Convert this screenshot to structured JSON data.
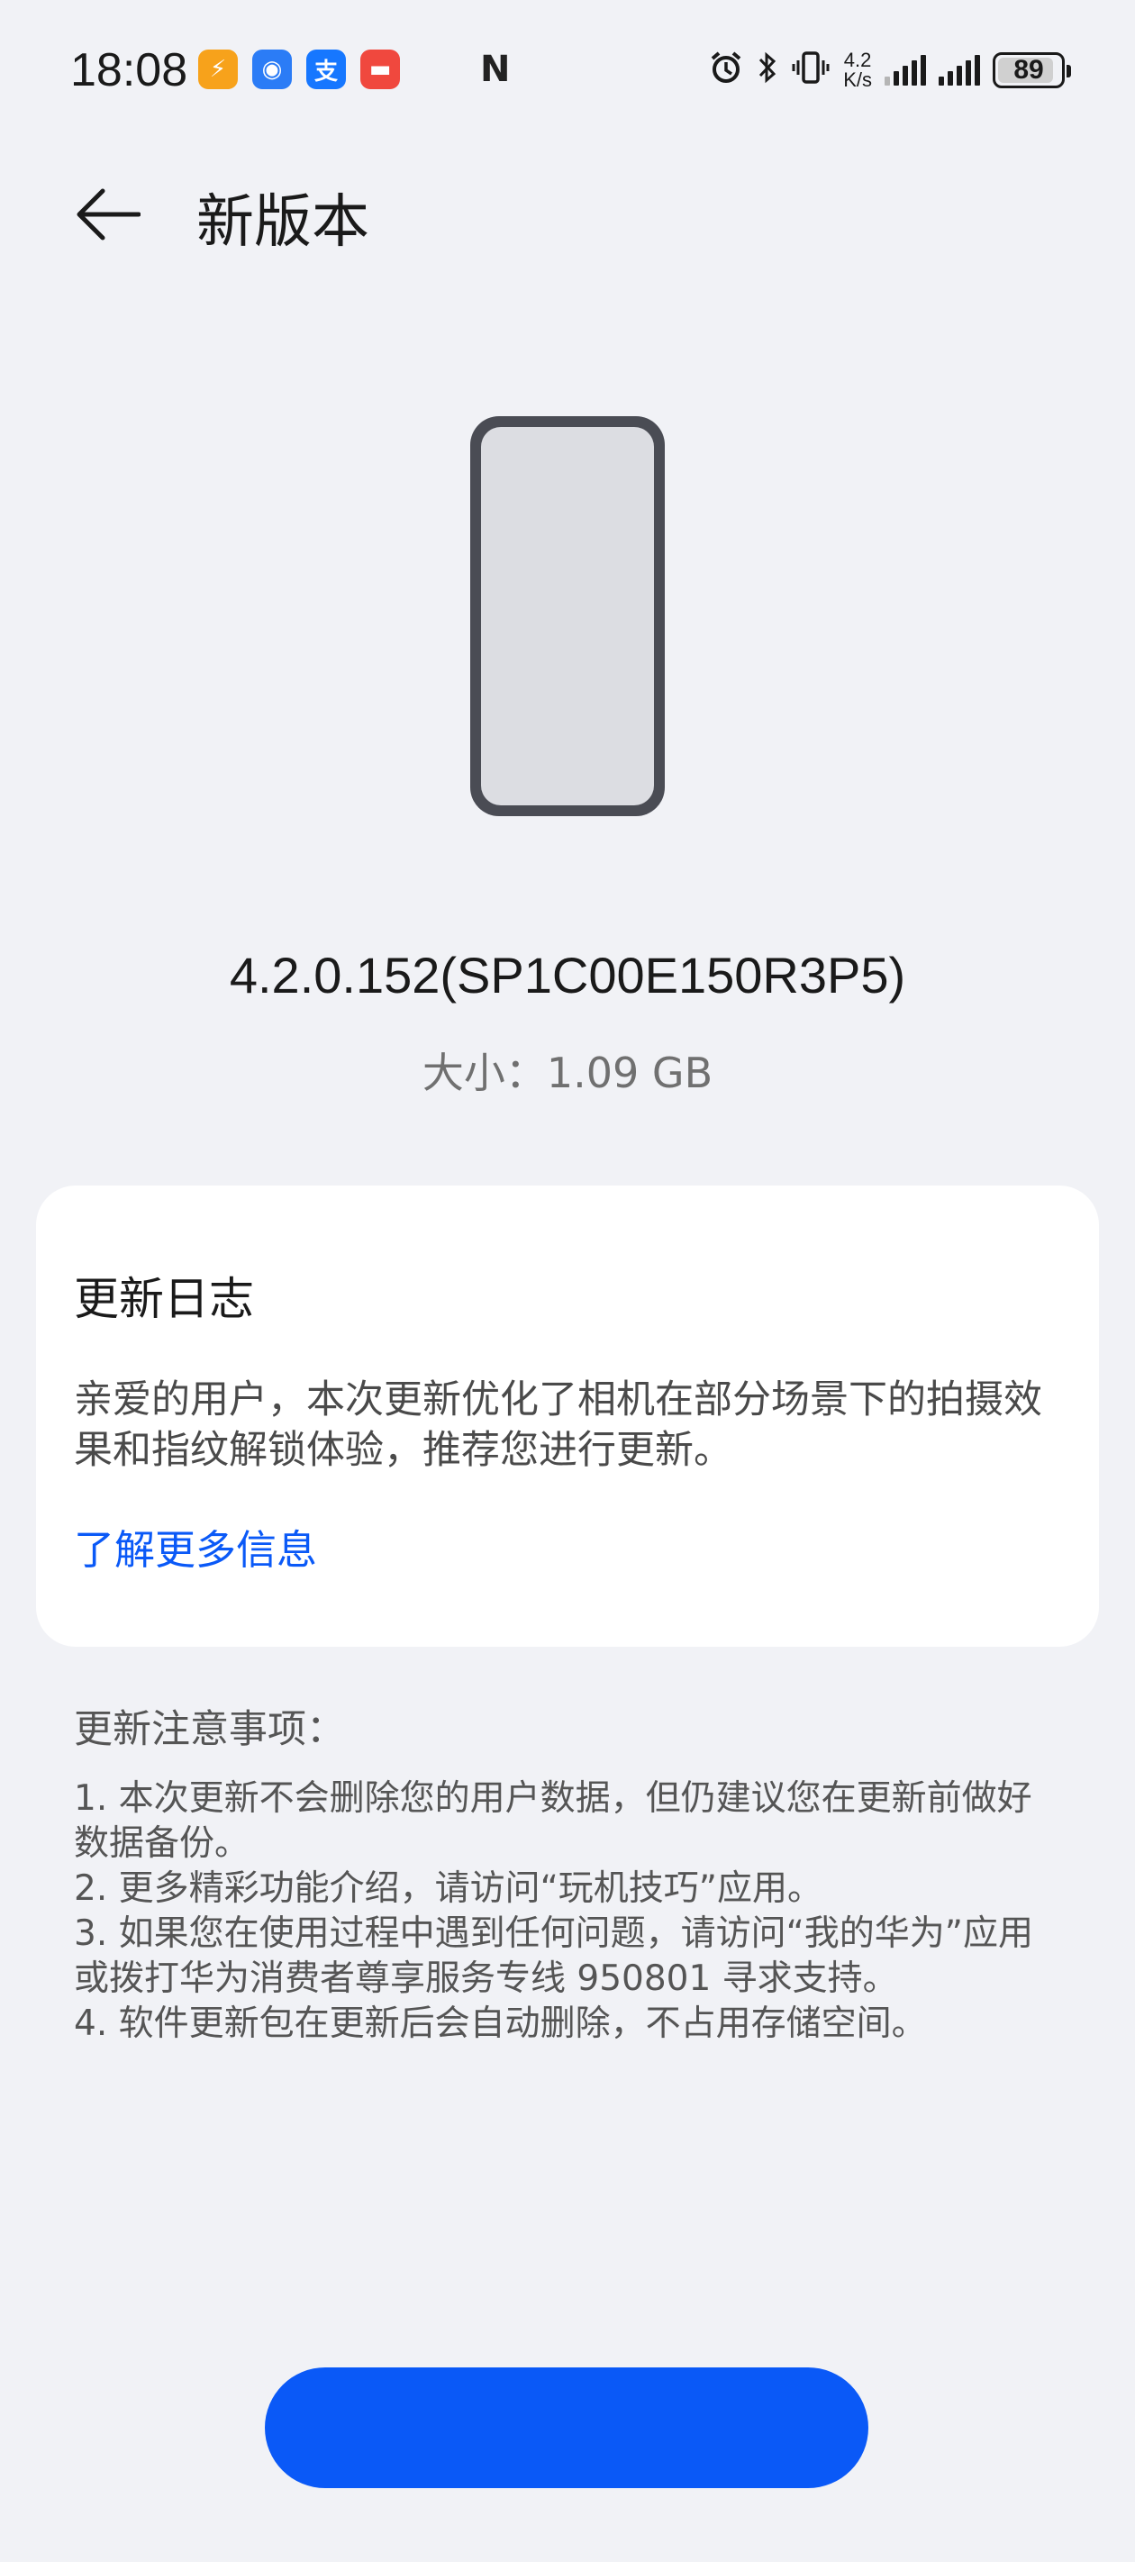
{
  "status_bar": {
    "time": "18:08",
    "app_icons": [
      {
        "name": "orange-app-icon",
        "glyph": "⚡",
        "color": "#f7a21b"
      },
      {
        "name": "blue-app-icon",
        "glyph": "◉",
        "color": "#2b7cf6"
      },
      {
        "name": "alipay-icon",
        "glyph": "支",
        "color": "#1677ff"
      },
      {
        "name": "red-app-icon",
        "glyph": "▬",
        "color": "#f0483e"
      }
    ],
    "nfc_icon": "N",
    "net_speed_value": "4.2",
    "net_speed_unit": "K/s",
    "battery_level": 89
  },
  "header": {
    "back_icon": "arrow-left",
    "title": "新版本"
  },
  "version": {
    "number": "4.2.0.152(SP1C00E150R3P5)",
    "size": "大小：1.09 GB"
  },
  "changelog": {
    "title": "更新日志",
    "body": "亲爱的用户，本次更新优化了相机在部分场景下的拍摄效果和指纹解锁体验，推荐您进行更新。",
    "link": "了解更多信息"
  },
  "notes": {
    "title": "更新注意事项：",
    "items": [
      "1. 本次更新不会删除您的用户数据，但仍建议您在更新前做好数据备份。",
      "2. 更多精彩功能介绍，请访问“玩机技巧”应用。",
      "3. 如果您在使用过程中遇到任何问题，请访问“我的华为”应用或拨打华为消费者尊享服务专线 950801 寻求支持。",
      "4. 软件更新包在更新后会自动删除，不占用存储空间。"
    ]
  },
  "action_button": {
    "label": "",
    "color": "#0a59f7"
  },
  "colors": {
    "background": "#f1f2f6",
    "card": "#ffffff",
    "accent": "#0a59f7"
  }
}
